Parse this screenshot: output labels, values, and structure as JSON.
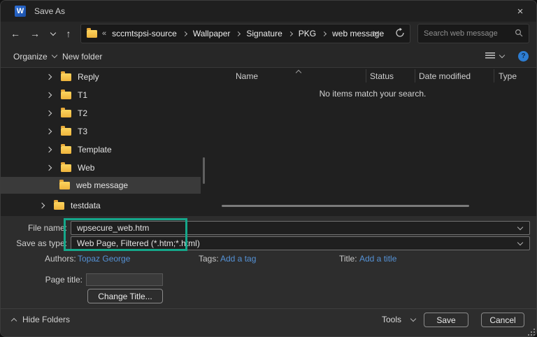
{
  "window": {
    "title": "Save As",
    "close_glyph": "×",
    "app": "Microsoft Word"
  },
  "nav": {
    "breadcrumb": {
      "prefix": "«",
      "segments": [
        "sccmtspsi-source",
        "Wallpaper",
        "Signature",
        "PKG",
        "web message"
      ]
    },
    "search": {
      "placeholder": "Search web message"
    }
  },
  "toolbar": {
    "organize": "Organize",
    "new_folder": "New folder"
  },
  "tree": {
    "items": [
      {
        "label": "Reply",
        "selected": false
      },
      {
        "label": "T1",
        "selected": false
      },
      {
        "label": "T2",
        "selected": false
      },
      {
        "label": "T3",
        "selected": false
      },
      {
        "label": "Template",
        "selected": false
      },
      {
        "label": "Web",
        "selected": false
      },
      {
        "label": "web message",
        "selected": true
      },
      {
        "label": "testdata",
        "selected": false
      }
    ]
  },
  "file_list": {
    "columns": [
      "Name",
      "Status",
      "Date modified",
      "Type"
    ],
    "empty_message": "No items match your search."
  },
  "fields": {
    "file_name": {
      "label": "File name:",
      "value": "wpsecure_web.htm"
    },
    "save_as_type": {
      "label": "Save as type:",
      "value": "Web Page, Filtered (*.htm;*.html)"
    },
    "authors": {
      "label": "Authors:",
      "value": "Topaz George"
    },
    "tags": {
      "label": "Tags:",
      "link": "Add a tag"
    },
    "doc_title": {
      "label": "Title:",
      "link": "Add a title"
    },
    "page_title": {
      "label": "Page title:",
      "value": ""
    }
  },
  "buttons": {
    "change_title": "Change Title...",
    "tools": "Tools",
    "save": "Save",
    "cancel": "Cancel"
  },
  "footer": {
    "hide_folders": "Hide Folders"
  },
  "colors": {
    "highlight_box": "#15a78a",
    "link_blue": "#5592d6",
    "help_blue": "#2d7dd2",
    "folder_yellow": "#f5c243",
    "word_blue": "#1e57b0"
  }
}
